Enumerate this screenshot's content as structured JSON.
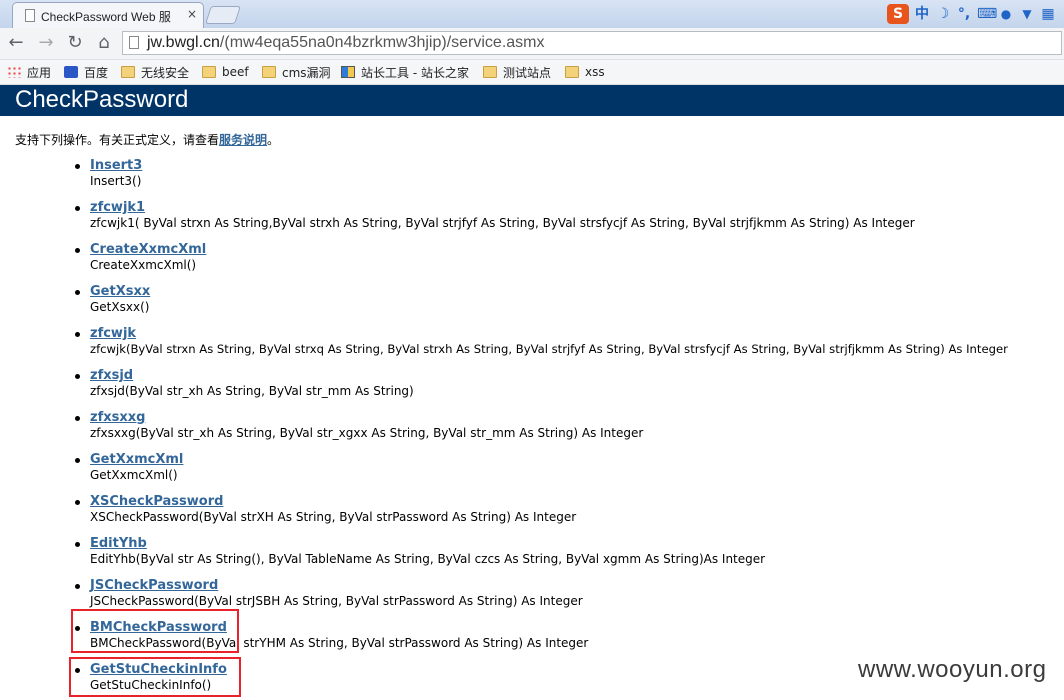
{
  "browser": {
    "tab_title": "CheckPassword Web 服",
    "tab_close": "×",
    "url_host": "jw.bwgl.cn",
    "url_path": "/(mw4eqa55na0n4bzrkmw3hjip)/service.asmx",
    "nav_back": "←",
    "nav_forward": "→",
    "nav_reload": "↻",
    "nav_home": "⌂",
    "ime": {
      "logo": "S",
      "mode": "中",
      "moon": "☽",
      "punct": "°,",
      "keyboard": "⌨",
      "user": "👤",
      "skin": "👕",
      "tools": "▦"
    },
    "bookmarks": [
      {
        "label": "应用",
        "icon": "apps-icon"
      },
      {
        "label": "百度",
        "icon": "baidu-icon"
      },
      {
        "label": "无线安全",
        "icon": "folder-icon"
      },
      {
        "label": "beef",
        "icon": "folder-icon"
      },
      {
        "label": "cms漏洞",
        "icon": "folder-icon"
      },
      {
        "label": "站长工具 - 站长之家",
        "icon": "chinaz-icon"
      },
      {
        "label": "测试站点",
        "icon": "folder-icon"
      },
      {
        "label": "xss",
        "icon": "folder-icon"
      }
    ]
  },
  "page": {
    "title": "CheckPassword",
    "intro_text": "支持下列操作。有关正式定义，请查看",
    "intro_link": "服务说明",
    "intro_end": "。",
    "operations": [
      {
        "name": "Insert3",
        "signature": "Insert3()"
      },
      {
        "name": "zfcwjk1",
        "signature": "zfcwjk1( ByVal strxn As String,ByVal strxh As String, ByVal strjfyf As String, ByVal strsfycjf As String, ByVal strjfjkmm As String) As Integer"
      },
      {
        "name": "CreateXxmcXml",
        "signature": "CreateXxmcXml()"
      },
      {
        "name": "GetXsxx",
        "signature": "GetXsxx()"
      },
      {
        "name": "zfcwjk",
        "signature": "zfcwjk(ByVal strxn As String, ByVal strxq As String, ByVal strxh As String, ByVal strjfyf As String, ByVal strsfycjf As String, ByVal strjfjkmm As String) As Integer"
      },
      {
        "name": "zfxsjd",
        "signature": "zfxsjd(ByVal str_xh As String, ByVal str_mm As String)"
      },
      {
        "name": "zfxsxxg",
        "signature": "zfxsxxg(ByVal str_xh As String, ByVal str_xgxx As String, ByVal str_mm As String) As Integer"
      },
      {
        "name": "GetXxmcXml",
        "signature": "GetXxmcXml()"
      },
      {
        "name": "XSCheckPassword",
        "signature": "XSCheckPassword(ByVal strXH As String, ByVal strPassword As String) As Integer"
      },
      {
        "name": "EditYhb",
        "signature": "EditYhb(ByVal str As String(), ByVal TableName As String, ByVal czcs As String, ByVal xgmm As String)As Integer"
      },
      {
        "name": "JSCheckPassword",
        "signature": "JSCheckPassword(ByVal strJSBH As String, ByVal strPassword As String) As Integer"
      },
      {
        "name": "BMCheckPassword",
        "signature": "BMCheckPassword(ByVal strYHM As String, ByVal strPassword As String) As Integer"
      },
      {
        "name": "GetStuCheckinInfo",
        "signature": "GetStuCheckinInfo()"
      }
    ],
    "highlight_color": "#e8232b",
    "header_color": "#003366",
    "link_color": "#336699"
  },
  "watermark": "www.wooyun.org"
}
